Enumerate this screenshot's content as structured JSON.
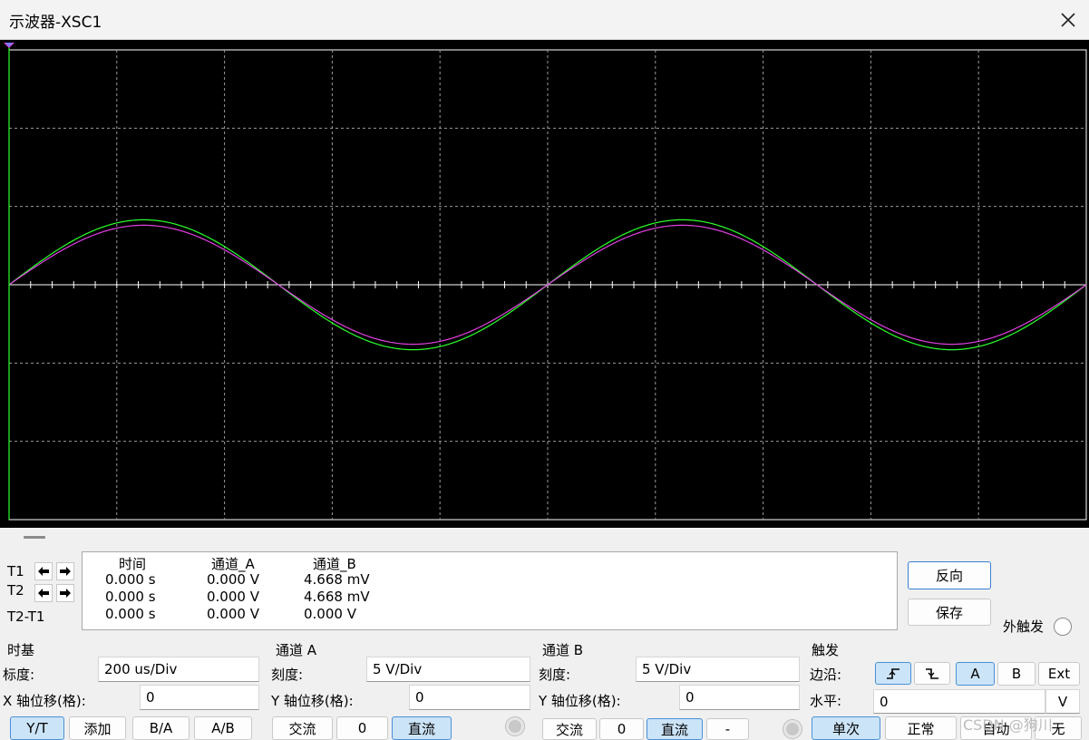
{
  "window": {
    "title": "示波器-XSC1",
    "close_icon": "close-icon"
  },
  "chart_data": {
    "type": "line",
    "title": "",
    "xlabel": "",
    "ylabel": "",
    "x_divisions": 10,
    "y_divisions": 6,
    "timebase": "200 us/Div",
    "xlim_divisions": [
      0,
      10
    ],
    "ylim_divisions": [
      -3,
      3
    ],
    "grid": true,
    "series": [
      {
        "channel": "A",
        "color": "#2bff2b",
        "amplitude_div": 0.83,
        "period_div": 5.0,
        "phase": "sine"
      },
      {
        "channel": "B",
        "color": "#e040e0",
        "amplitude_div": 0.76,
        "period_div": 5.0,
        "phase": "sine"
      }
    ]
  },
  "cursors": {
    "t1_label": "T1",
    "t2_label": "T2",
    "diff_label": "T2-T1",
    "headers": {
      "time": "时间",
      "channel_a": "通道_A",
      "channel_b": "通道_B"
    },
    "rows": [
      {
        "time": "0.000 s",
        "channel_a": "0.000 V",
        "channel_b": "4.668 mV"
      },
      {
        "time": "0.000 s",
        "channel_a": "0.000 V",
        "channel_b": "4.668 mV"
      },
      {
        "time": "0.000 s",
        "channel_a": "0.000 V",
        "channel_b": "0.000 V"
      }
    ]
  },
  "side": {
    "reverse_label": "反向",
    "save_label": "保存",
    "ext_trigger_label": "外触发"
  },
  "timebase": {
    "section_label": "时基",
    "scale_label": "标度:",
    "scale_value": "200 us/Div",
    "xpos_label": "X 轴位移(格):",
    "xpos_value": "0",
    "modes": [
      "Y/T",
      "添加",
      "B/A",
      "A/B"
    ],
    "active_mode": "Y/T"
  },
  "channel_a": {
    "section_label": "通道 A",
    "scale_label": "刻度:",
    "scale_value": "5  V/Div",
    "ypos_label": "Y 轴位移(格):",
    "ypos_value": "0",
    "couplings": [
      "交流",
      "0",
      "直流"
    ],
    "active_coupling": "直流"
  },
  "channel_b": {
    "section_label": "通道 B",
    "scale_label": "刻度:",
    "scale_value": "5  V/Div",
    "ypos_label": "Y 轴位移(格):",
    "ypos_value": "0",
    "couplings": [
      "交流",
      "0",
      "直流",
      "-"
    ],
    "active_coupling": "直流"
  },
  "trigger": {
    "section_label": "触发",
    "edge_label": "边沿:",
    "sources": [
      "A",
      "B",
      "Ext"
    ],
    "active_source": "A",
    "level_label": "水平:",
    "level_value": "0",
    "level_unit": "V",
    "modes": [
      "单次",
      "正常",
      "自动",
      "无"
    ],
    "active_mode": "单次"
  },
  "watermark": "CSDN @狗川"
}
